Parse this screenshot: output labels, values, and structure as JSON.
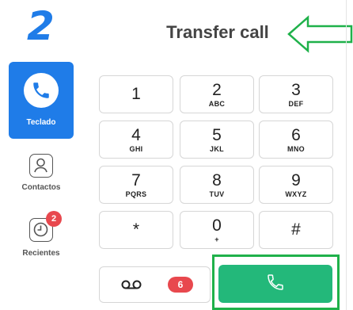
{
  "annotation": {
    "step_number": "2",
    "highlight_color": "#1fb14a"
  },
  "sidebar": {
    "active_color": "#1f7ce8",
    "items": [
      {
        "label": "Teclado",
        "icon": "phone-icon",
        "active": true
      },
      {
        "label": "Contactos",
        "icon": "contact-card-icon",
        "active": false
      },
      {
        "label": "Recientes",
        "icon": "clock-icon",
        "active": false,
        "badge": "2"
      }
    ]
  },
  "header": {
    "title": "Transfer call"
  },
  "dialpad": {
    "keys": [
      {
        "digit": "1",
        "letters": ""
      },
      {
        "digit": "2",
        "letters": "ABC"
      },
      {
        "digit": "3",
        "letters": "DEF"
      },
      {
        "digit": "4",
        "letters": "GHI"
      },
      {
        "digit": "5",
        "letters": "JKL"
      },
      {
        "digit": "6",
        "letters": "MNO"
      },
      {
        "digit": "7",
        "letters": "PQRS"
      },
      {
        "digit": "8",
        "letters": "TUV"
      },
      {
        "digit": "9",
        "letters": "WXYZ"
      },
      {
        "digit": "*",
        "letters": ""
      },
      {
        "digit": "0",
        "letters": "+"
      },
      {
        "digit": "#",
        "letters": ""
      }
    ]
  },
  "voicemail": {
    "icon": "voicemail-icon",
    "count": "6"
  },
  "call_button": {
    "icon": "phone-icon",
    "color": "#23b87a"
  }
}
